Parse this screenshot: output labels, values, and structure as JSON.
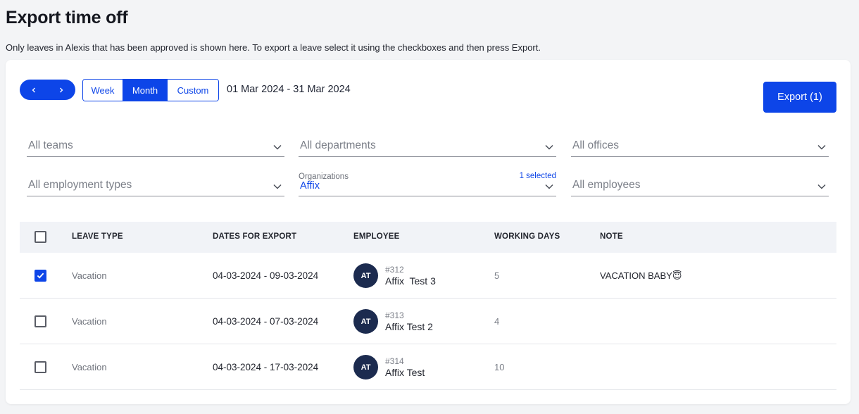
{
  "page": {
    "title": "Export time off",
    "description": "Only leaves in Alexis that has been approved is shown here. To export a leave select it using the checkboxes and then press Export."
  },
  "toolbar": {
    "prev_icon": "chevron-left-icon",
    "next_icon": "chevron-right-icon",
    "periods": [
      "Week",
      "Month",
      "Custom"
    ],
    "active_period": "Month",
    "date_range": "01 Mar 2024 - 31 Mar 2024",
    "export_label": "Export (1)"
  },
  "filters": {
    "teams": "All teams",
    "departments": "All departments",
    "offices": "All offices",
    "employment_types": "All employment types",
    "organizations": {
      "label": "Organizations",
      "count": "1 selected",
      "value": "Affix"
    },
    "employees": "All employees"
  },
  "table": {
    "headers": [
      "LEAVE TYPE",
      "DATES FOR EXPORT",
      "EMPLOYEE",
      "WORKING DAYS",
      "NOTE"
    ],
    "rows": [
      {
        "checked": true,
        "leave_type": "Vacation",
        "dates": "04-03-2024 - 09-03-2024",
        "initials": "AT",
        "employee_id": "#312",
        "employee_name": "Affix  Test 3",
        "working_days": "5",
        "note": "VACATION BABY😇"
      },
      {
        "checked": false,
        "leave_type": "Vacation",
        "dates": "04-03-2024 - 07-03-2024",
        "initials": "AT",
        "employee_id": "#313",
        "employee_name": "Affix Test 2",
        "working_days": "4",
        "note": ""
      },
      {
        "checked": false,
        "leave_type": "Vacation",
        "dates": "04-03-2024 - 17-03-2024",
        "initials": "AT",
        "employee_id": "#314",
        "employee_name": "Affix Test",
        "working_days": "10",
        "note": ""
      }
    ]
  },
  "colors": {
    "primary": "#0d45e8",
    "avatar": "#1c2b4f",
    "header_bg": "#f1f3f7"
  }
}
